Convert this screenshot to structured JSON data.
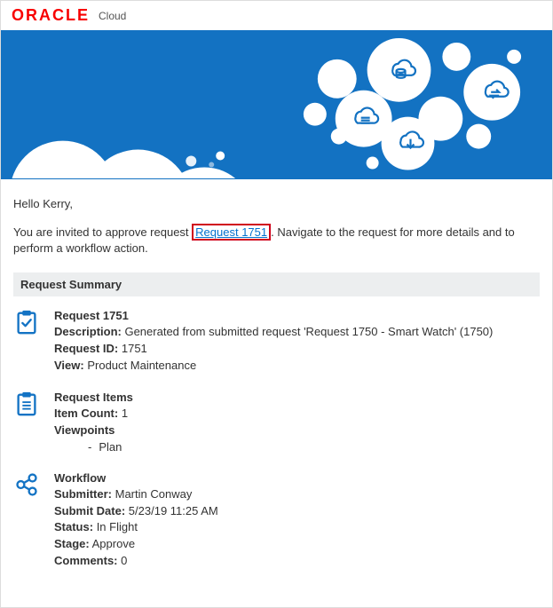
{
  "brand": {
    "vendor": "ORACLE",
    "product": "Cloud"
  },
  "greeting": "Hello Kerry,",
  "intro": {
    "pre": "You are invited to approve request ",
    "link_text": "Request 1751",
    "post": ". Navigate to the request for more details and to perform a workflow action."
  },
  "section_title": "Request Summary",
  "summary": {
    "title": "Request 1751",
    "description_label": "Description:",
    "description_value": "Generated from submitted request 'Request 1750 - Smart Watch' (1750)",
    "id_label": "Request ID:",
    "id_value": "1751",
    "view_label": "View:",
    "view_value": "Product Maintenance"
  },
  "items": {
    "title": "Request Items",
    "count_label": "Item Count:",
    "count_value": "1",
    "viewpoints_label": "Viewpoints",
    "viewpoints": [
      "Plan"
    ]
  },
  "workflow": {
    "title": "Workflow",
    "submitter_label": "Submitter:",
    "submitter_value": "Martin Conway",
    "submit_date_label": "Submit Date:",
    "submit_date_value": "5/23/19 11:25 AM",
    "status_label": "Status:",
    "status_value": "In Flight",
    "stage_label": "Stage:",
    "stage_value": "Approve",
    "comments_label": "Comments:",
    "comments_value": "0"
  }
}
